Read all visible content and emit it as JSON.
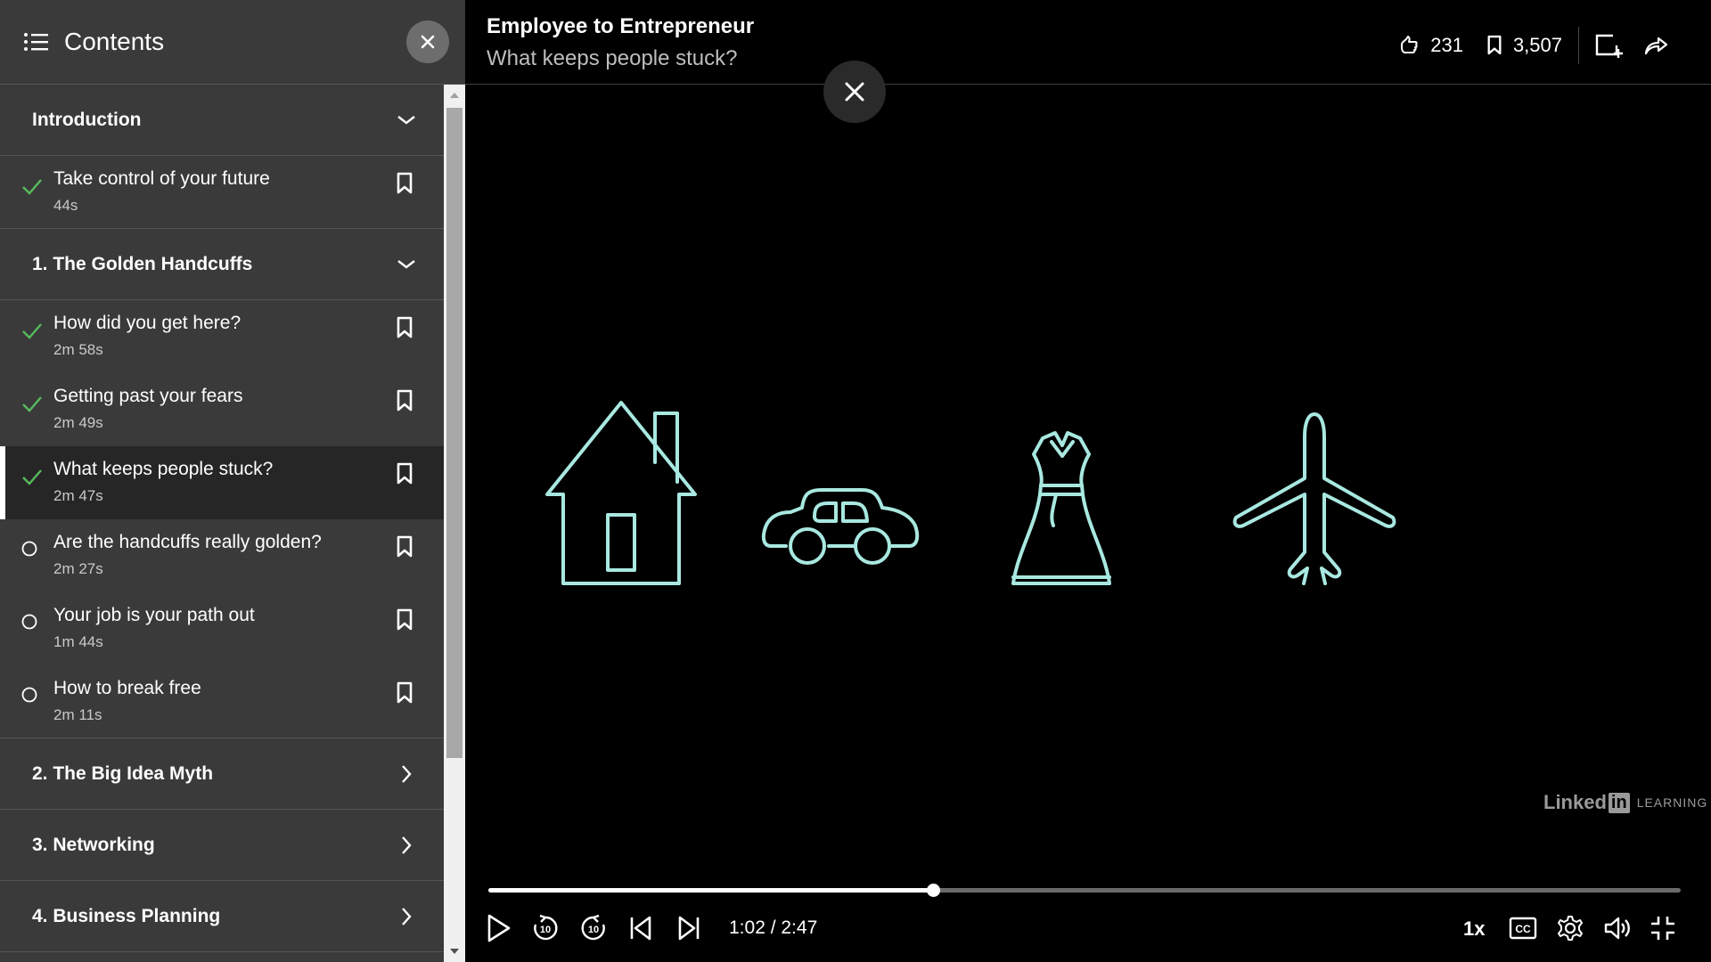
{
  "sidebar": {
    "title": "Contents",
    "sections": [
      {
        "label": "Introduction",
        "expanded": true,
        "items": [
          {
            "title": "Take control of your future",
            "duration": "44s",
            "status": "complete"
          }
        ]
      },
      {
        "label": "1. The Golden Handcuffs",
        "expanded": true,
        "items": [
          {
            "title": "How did you get here?",
            "duration": "2m 58s",
            "status": "complete"
          },
          {
            "title": "Getting past your fears",
            "duration": "2m 49s",
            "status": "complete"
          },
          {
            "title": "What keeps people stuck?",
            "duration": "2m 47s",
            "status": "complete",
            "active": true
          },
          {
            "title": "Are the handcuffs really golden?",
            "duration": "2m 27s",
            "status": "incomplete"
          },
          {
            "title": "Your job is your path out",
            "duration": "1m 44s",
            "status": "incomplete"
          },
          {
            "title": "How to break free",
            "duration": "2m 11s",
            "status": "incomplete"
          }
        ]
      },
      {
        "label": "2. The Big Idea Myth",
        "expanded": false
      },
      {
        "label": "3. Networking",
        "expanded": false
      },
      {
        "label": "4. Business Planning",
        "expanded": false
      }
    ]
  },
  "header": {
    "course_title": "Employee to Entrepreneur",
    "video_title": "What keeps people stuck?",
    "likes": "231",
    "saves": "3,507"
  },
  "watermark": {
    "linked": "Linked",
    "in": "in",
    "learning": "LEARNING"
  },
  "player": {
    "progress": 0.373,
    "time": "1:02 / 2:47",
    "speed": "1x"
  },
  "colors": {
    "check": "#57bb5d",
    "icon_line": "#a8e8e0",
    "sidebar_bg": "#3a3a3a",
    "active_bg": "#262626"
  }
}
